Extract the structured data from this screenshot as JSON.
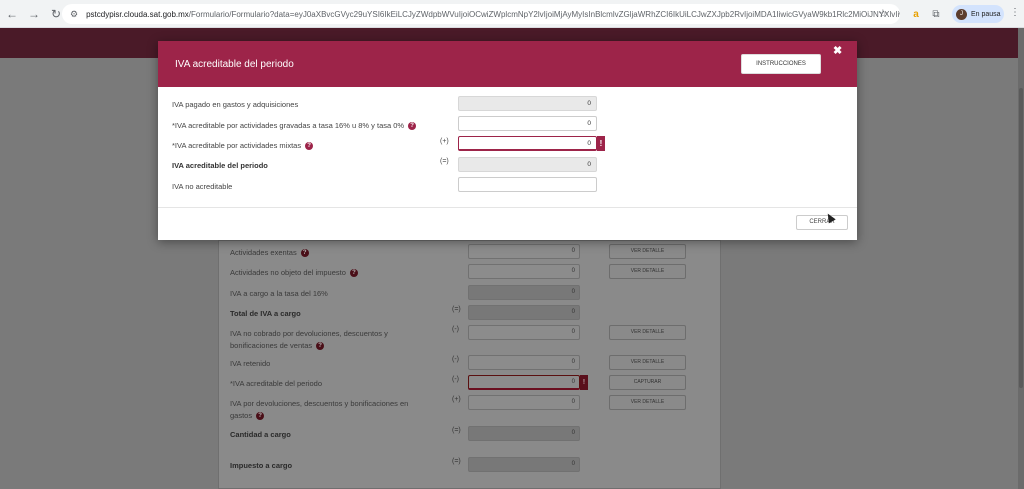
{
  "browser": {
    "url_host": "pstcdypisr.clouda.sat.gob.mx",
    "url_rest": "/Formulario/Formulario?data=eyJ0aXBvcGVyc29uYSI6IkEiLCJyZWdpbWVuIjoiOCwiZWplcmNpY2lvIjoiMjAyMyIsInBlcmlvZGljaWRhZCI6IkUiLCJwZXJpb2RvIjoiMDA1IiwicGVyaW9kb1Rlc2MiOiJNYXlvIiwiZmVjaGFGDY...",
    "profile_label": "En pausa",
    "profile_initial": "J"
  },
  "modal": {
    "title": "IVA acreditable del periodo",
    "instrucciones_label": "INSTRUCCIONES",
    "close_symbol": "✖",
    "cerrar_label": "CERRAR",
    "rows": [
      {
        "label": "IVA pagado en gastos y adquisiciones",
        "sign": "",
        "value": "0",
        "help": false
      },
      {
        "label": "*IVA acreditable por actividades gravadas a tasa 16% u 8% y tasa 0%",
        "sign": "",
        "value": "0",
        "help": true
      },
      {
        "label": "*IVA acreditable por actividades mixtas",
        "sign": "(+)",
        "value": "0",
        "help": true
      },
      {
        "label": "IVA acreditable del periodo",
        "sign": "(=)",
        "value": "0",
        "help": false
      },
      {
        "label": "IVA no acreditable",
        "sign": "",
        "value": "",
        "help": false
      }
    ],
    "error_flag": "!"
  },
  "background": {
    "rows": [
      {
        "label": "Actividades exentas",
        "value": "0",
        "btn": "VER DETALLE",
        "help": true
      },
      {
        "label": "Actividades no objeto del impuesto",
        "value": "0",
        "btn": "VER DETALLE",
        "help": true
      },
      {
        "label": "IVA a cargo a la tasa del 16%",
        "value": "0",
        "btn": "",
        "help": false
      },
      {
        "label": "Total de IVA a cargo",
        "sign": "(=)",
        "value": "0",
        "btn": ""
      },
      {
        "label": "IVA no cobrado por devoluciones, descuentos y",
        "label2": "bonificaciones de ventas",
        "sign": "(-)",
        "value": "0",
        "btn": "VER DETALLE"
      },
      {
        "label": "IVA retenido",
        "sign": "(-)",
        "value": "0",
        "btn": "VER DETALLE"
      },
      {
        "label": "*IVA acreditable del periodo",
        "sign": "(-)",
        "value": "0",
        "btn": "CAPTURAR"
      },
      {
        "label": "IVA por devoluciones, descuentos y bonificaciones en",
        "label2": "gastos",
        "sign": "(+)",
        "value": "0",
        "btn": "VER DETALLE"
      },
      {
        "label": "Cantidad a cargo",
        "sign": "(=)",
        "value": "0",
        "btn": ""
      },
      {
        "label": "Impuesto a cargo",
        "sign": "(=)",
        "value": "0",
        "btn": ""
      }
    ],
    "help_symbol": "?",
    "error_flag": "!"
  },
  "colors": {
    "brand": "#9d2449",
    "band_dark": "#4a1a28"
  }
}
